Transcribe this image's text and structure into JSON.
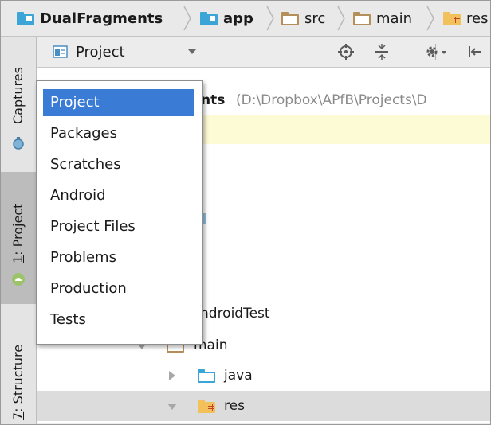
{
  "breadcrumb": [
    {
      "label": "DualFragments",
      "icon": "module-folder-icon",
      "bold": true
    },
    {
      "label": "app",
      "icon": "module-folder-icon",
      "bold": true
    },
    {
      "label": "src",
      "icon": "folder-icon",
      "bold": false
    },
    {
      "label": "main",
      "icon": "folder-icon",
      "bold": false
    },
    {
      "label": "res",
      "icon": "resource-folder-icon",
      "bold": false
    }
  ],
  "side_tabs": {
    "captures": "Captures",
    "project_num": "1",
    "project": ": Project",
    "structure_num": "7",
    "structure": ": Structure"
  },
  "project_view": {
    "selected": "Project",
    "options": [
      "Project",
      "Packages",
      "Scratches",
      "Android",
      "Project Files",
      "Problems",
      "Production",
      "Tests"
    ]
  },
  "toolbar_icons": [
    "locate-icon",
    "collapse-all-icon",
    "settings-icon",
    "hide-panel-icon"
  ],
  "tree": {
    "root_name": "nts",
    "root_path": "(D:\\Dropbox\\APfB\\Projects\\D",
    "android_test": "ndroidTest",
    "main": "main",
    "java": "java",
    "res": "res"
  },
  "colors": {
    "selection": "#3a7bd5",
    "folder_blue": "#3aa5d6",
    "folder_tan": "#d4b583",
    "res_yellow": "#f2c15b"
  }
}
